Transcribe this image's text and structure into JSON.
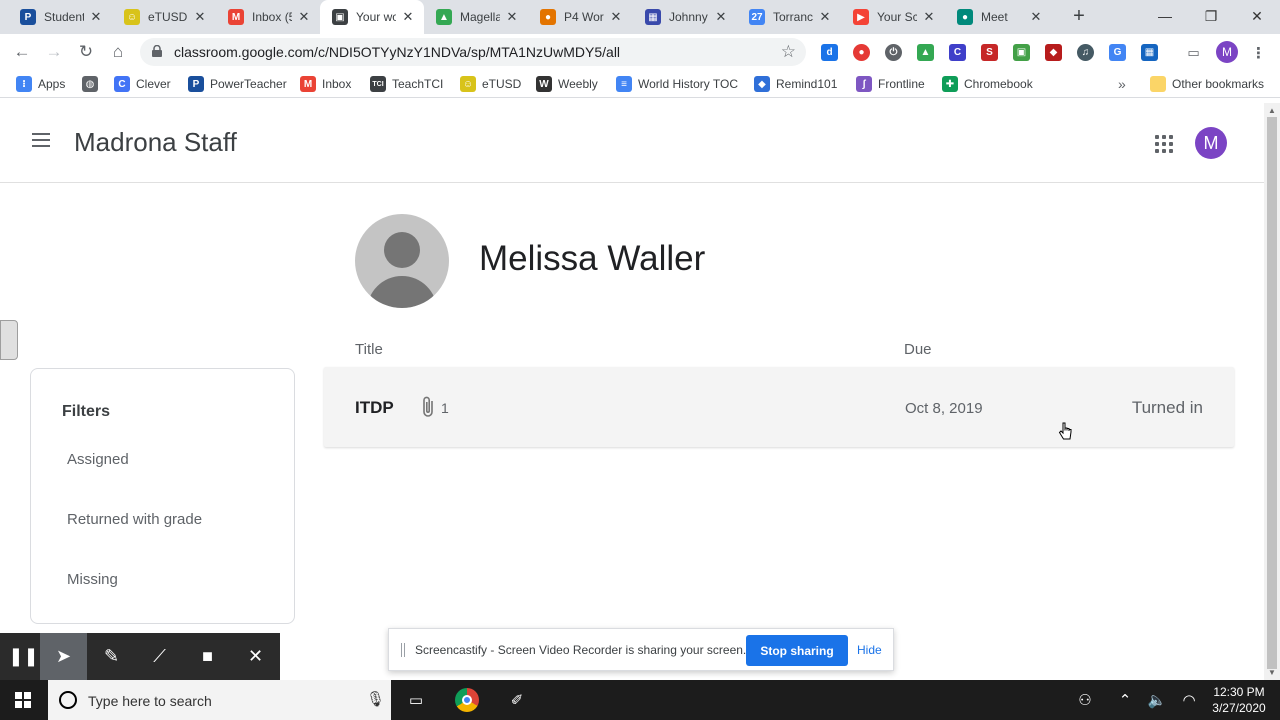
{
  "browser": {
    "tabs": [
      {
        "title": "Student",
        "icon": "powerschool-icon",
        "color": "#1a4f9c",
        "glyph": "P",
        "active": false
      },
      {
        "title": "eTUSD:",
        "icon": "smiley-icon",
        "color": "#d8c31a",
        "glyph": "☺",
        "active": false
      },
      {
        "title": "Inbox (5",
        "icon": "gmail-icon",
        "color": "#ea4335",
        "glyph": "M",
        "active": false
      },
      {
        "title": "Your wo",
        "icon": "classroom-icon",
        "color": "#3c4043",
        "glyph": "▣",
        "active": true
      },
      {
        "title": "Magella",
        "icon": "drive-icon",
        "color": "#34a853",
        "glyph": "▲",
        "active": false
      },
      {
        "title": "P4 Wor",
        "icon": "person-icon",
        "color": "#e37400",
        "glyph": "●",
        "active": false
      },
      {
        "title": "Johnny",
        "icon": "forms-icon",
        "color": "#3949ab",
        "glyph": "▦",
        "active": false
      },
      {
        "title": "Torranc",
        "icon": "calendar-icon",
        "color": "#4285f4",
        "glyph": "27",
        "active": false
      },
      {
        "title": "Your Sc",
        "icon": "screencastify-icon",
        "color": "#f44336",
        "glyph": "▶",
        "active": false
      },
      {
        "title": "Meet",
        "icon": "meet-icon",
        "color": "#00897b",
        "glyph": "●",
        "active": false
      }
    ],
    "new_tab_label": "+",
    "url": "classroom.google.com/c/NDI5OTYyNzY1NDVa/sp/MTA1NzUwMDY5/all",
    "bookmarks": [
      {
        "label": "Apps",
        "icon": "apps-grid-icon",
        "color": "#4285f4",
        "glyph": "⁝"
      },
      {
        "label": "",
        "icon": "globe-icon",
        "color": "#5f6368",
        "glyph": "◍"
      },
      {
        "label": "Clever",
        "icon": "clever-icon",
        "color": "#4274f6",
        "glyph": "C"
      },
      {
        "label": "PowerTeacher",
        "icon": "powerteacher-icon",
        "color": "#1a4f9c",
        "glyph": "P"
      },
      {
        "label": "Inbox",
        "icon": "gmail-icon",
        "color": "#ea4335",
        "glyph": "M"
      },
      {
        "label": "TeachTCI",
        "icon": "tci-icon",
        "color": "#3c4043",
        "glyph": "TCI"
      },
      {
        "label": "eTUSD",
        "icon": "smiley-icon",
        "color": "#d8c31a",
        "glyph": "☺"
      },
      {
        "label": "Weebly",
        "icon": "weebly-icon",
        "color": "#333333",
        "glyph": "W"
      },
      {
        "label": "World History TOC",
        "icon": "docs-icon",
        "color": "#4285f4",
        "glyph": "≡"
      },
      {
        "label": "Remind101",
        "icon": "remind-icon",
        "color": "#2f6fd8",
        "glyph": "◆"
      },
      {
        "label": "Frontline",
        "icon": "frontline-icon",
        "color": "#7e57c2",
        "glyph": "ʃ"
      },
      {
        "label": "Chromebook",
        "icon": "sheets-icon",
        "color": "#0f9d58",
        "glyph": "✚"
      }
    ],
    "bookmarks_overflow": "»",
    "other_bookmarks": "Other bookmarks",
    "profile_initial": "M"
  },
  "classroom": {
    "app_title": "Madrona Staff",
    "account_initial": "M",
    "student_name": "Melissa Waller",
    "columns": {
      "title": "Title",
      "due": "Due"
    },
    "filters": {
      "heading": "Filters",
      "items": [
        "Assigned",
        "Returned with grade",
        "Missing"
      ]
    },
    "assignments": [
      {
        "title": "ITDP",
        "attachments": "1",
        "due": "Oct 8, 2019",
        "status": "Turned in"
      }
    ]
  },
  "screencastify": {
    "share_message": "Screencastify - Screen Video Recorder is sharing your screen.",
    "stop_label": "Stop sharing",
    "hide_label": "Hide"
  },
  "taskbar": {
    "search_placeholder": "Type here to search",
    "time": "12:30 PM",
    "date": "3/27/2020"
  },
  "colors": {
    "accent": "#1a73e8",
    "avatar": "#7b44c4"
  }
}
